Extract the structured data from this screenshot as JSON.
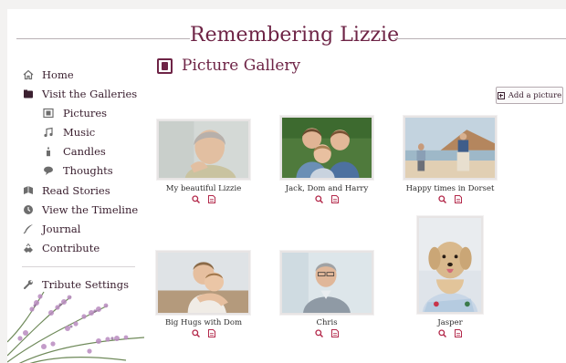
{
  "site": {
    "title": "Remembering Lizzie"
  },
  "nav": {
    "items": [
      {
        "label": "Home",
        "icon": "home-icon"
      },
      {
        "label": "Visit the Galleries",
        "icon": "folder-icon"
      },
      {
        "label": "Pictures",
        "icon": "picture-icon"
      },
      {
        "label": "Music",
        "icon": "music-note-icon"
      },
      {
        "label": "Candles",
        "icon": "candle-icon"
      },
      {
        "label": "Thoughts",
        "icon": "speech-bubble-icon"
      },
      {
        "label": "Read Stories",
        "icon": "book-icon"
      },
      {
        "label": "View the Timeline",
        "icon": "clock-icon"
      },
      {
        "label": "Journal",
        "icon": "quill-icon"
      },
      {
        "label": "Contribute",
        "icon": "hands-icon"
      },
      {
        "label": "Tribute Settings",
        "icon": "wrench-icon"
      }
    ]
  },
  "main": {
    "title": "Picture Gallery",
    "add_button": "Add a picture"
  },
  "gallery": [
    {
      "caption": "My beautiful Lizzie"
    },
    {
      "caption": "Jack, Dom and Harry"
    },
    {
      "caption": "Happy times in Dorset"
    },
    {
      "caption": "Big Hugs with Dom"
    },
    {
      "caption": "Chris"
    },
    {
      "caption": "Jasper"
    }
  ],
  "colors": {
    "accent": "#6e2446",
    "icon_red": "#b3284a",
    "text": "#3b2030"
  }
}
